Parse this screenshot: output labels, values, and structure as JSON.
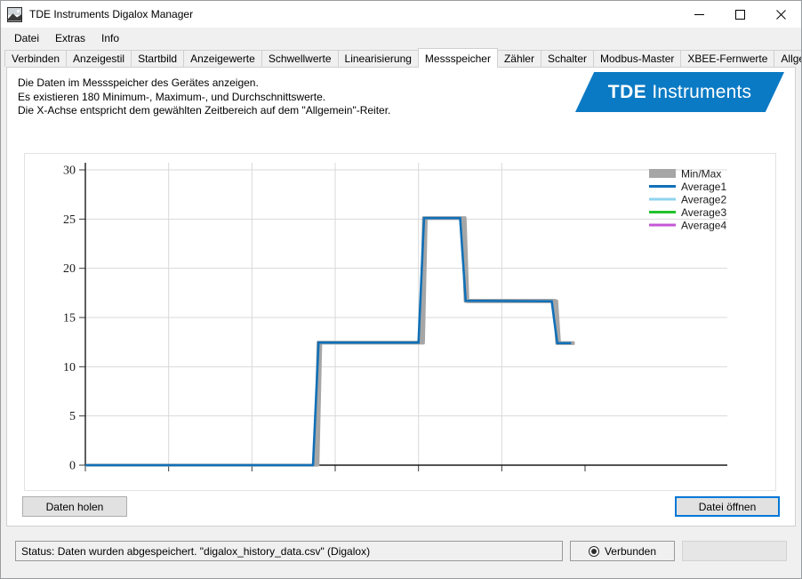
{
  "window": {
    "title": "TDE Instruments Digalox Manager",
    "icon": "app-picture-icon",
    "minimize_label": "—",
    "maximize_label": "□",
    "close_label": "✕"
  },
  "menu": {
    "items": [
      {
        "label": "Datei"
      },
      {
        "label": "Extras"
      },
      {
        "label": "Info"
      }
    ]
  },
  "tabs": {
    "items": [
      {
        "label": "Verbinden",
        "active": false
      },
      {
        "label": "Anzeigestil",
        "active": false
      },
      {
        "label": "Startbild",
        "active": false
      },
      {
        "label": "Anzeigewerte",
        "active": false
      },
      {
        "label": "Schwellwerte",
        "active": false
      },
      {
        "label": "Linearisierung",
        "active": false
      },
      {
        "label": "Messspeicher",
        "active": true
      },
      {
        "label": "Zähler",
        "active": false
      },
      {
        "label": "Schalter",
        "active": false
      },
      {
        "label": "Modbus-Master",
        "active": false
      },
      {
        "label": "XBEE-Fernwerte",
        "active": false
      },
      {
        "label": "Allgemein",
        "active": false
      }
    ]
  },
  "description": {
    "line1": "Die Daten im Messspeicher des Gerätes anzeigen.",
    "line2": "Es existieren 180 Minimum-, Maximum-, und Durchschnittswerte.",
    "line3": "Die X-Achse entspricht dem gewählten Zeitbereich auf dem \"Allgemein\"-Reiter."
  },
  "logo": {
    "bold": "TDE",
    "light": "Instruments",
    "color": "#0b7ac4"
  },
  "buttons": {
    "fetch_data": "Daten holen",
    "open_file": "Datei öffnen"
  },
  "status": {
    "text": "Status: Daten wurden abgespeichert. \"digalox_history_data.csv\" (Digalox)",
    "connection": "Verbunden",
    "connection_icon": "radio-filled-icon"
  },
  "chart_data": {
    "type": "line",
    "title": "",
    "xlabel": "",
    "ylabel": "",
    "ylim": [
      0,
      30
    ],
    "yticks": [
      0,
      5,
      10,
      15,
      20,
      25,
      30
    ],
    "xlim": [
      0,
      180
    ],
    "xticks": [
      0,
      30,
      60,
      90,
      120,
      150,
      180
    ],
    "xtick_labels": [
      "",
      "",
      "",
      "",
      "",
      "",
      ""
    ],
    "grid": true,
    "legend_position": "top-right",
    "legend": [
      {
        "name": "Min/Max",
        "color": "#a6a6a6",
        "style": "band"
      },
      {
        "name": "Average1",
        "color": "#1070b8",
        "style": "line"
      },
      {
        "name": "Average2",
        "color": "#8fd3f0",
        "style": "line"
      },
      {
        "name": "Average3",
        "color": "#22c32b",
        "style": "line"
      },
      {
        "name": "Average4",
        "color": "#c457d4",
        "style": "line"
      }
    ],
    "x": [
      0,
      82,
      83,
      84,
      120,
      121,
      122,
      135,
      136,
      137,
      168,
      169,
      170,
      175
    ],
    "series": [
      {
        "name": "Average1",
        "color": "#1070b8",
        "values": [
          0,
          0,
          6.2,
          12.45,
          12.45,
          18.8,
          25.1,
          25.1,
          20.9,
          16.7,
          16.65,
          14.5,
          12.4,
          12.4
        ]
      },
      {
        "name": "Min/Max",
        "style": "band",
        "color": "#a6a6a6",
        "min": [
          0,
          0,
          0,
          12.4,
          12.4,
          12.4,
          25.05,
          25.05,
          16.65,
          16.6,
          16.6,
          12.35,
          12.35,
          12.35
        ],
        "max": [
          0,
          0,
          12.5,
          12.5,
          12.5,
          25.15,
          25.15,
          25.15,
          25.15,
          16.75,
          16.75,
          16.7,
          12.45,
          12.45
        ]
      }
    ],
    "notes": "Step-like trace: flat at 0 until ~46% of x-range, steps to 12.45, steps up to 25.1 plateau, drops to 16.7 plateau, drops back to 12.4 near end."
  }
}
